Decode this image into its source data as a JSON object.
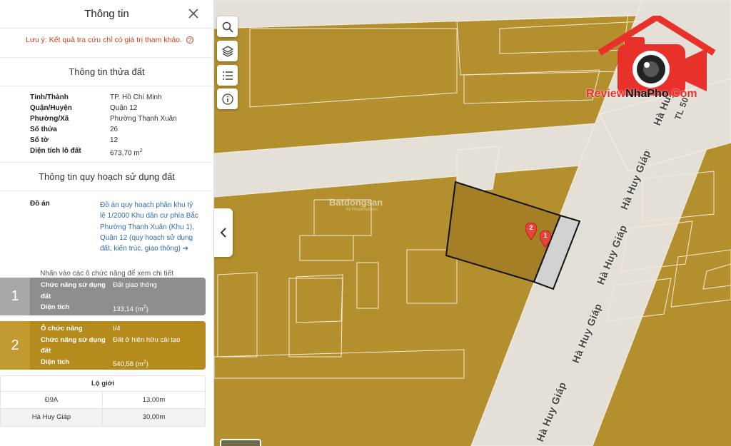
{
  "panel": {
    "title": "Thông tin",
    "note": "Lưu ý: Kết quả tra cứu chỉ có giá trị tham khảo.",
    "note_icon": "?",
    "land_section_title": "Thông tin thửa đất",
    "land_info": [
      {
        "label": "Tỉnh/Thành",
        "value": "TP. Hồ Chí Minh"
      },
      {
        "label": "Quận/Huyện",
        "value": "Quận 12"
      },
      {
        "label": "Phường/Xã",
        "value": "Phường Thạnh Xuân"
      },
      {
        "label": "Số thửa",
        "value": "26"
      },
      {
        "label": "Số tờ",
        "value": "12"
      },
      {
        "label": "Diện tích lô đất",
        "value": "673,70 m",
        "unit_sup": "2"
      }
    ],
    "planning_section_title": "Thông tin quy hoạch sử dụng đất",
    "project_label": "Đồ án",
    "project_link": "Đồ án quy hoạch phân khu tỷ lệ 1/2000 Khu dân cư phía Bắc Phường Thạnh Xuân (Khu 1), Quận 12 (quy hoạch sử dụng đất, kiến trúc, giao thông)",
    "project_arrow": "➔",
    "hint": "Nhấn vào các ô chức năng để xem chi tiết",
    "zones": [
      {
        "number": "1",
        "color": "#8e8e8e",
        "function_label": "Chức năng sử dụng đất",
        "function_value": "Đất giao thông",
        "area_label": "Diện tích",
        "area_value": "133,14 (m",
        "area_sup": "2",
        "area_close": ")"
      },
      {
        "number": "2",
        "color": "#b68b1e",
        "cell_label": "Ô chức năng",
        "cell_value": "I/4",
        "function_label": "Chức năng sử dụng đất",
        "function_value": "Đất ở hiện hữu cải tạo",
        "area_label": "Diện tích",
        "area_value": "540,58 (m",
        "area_sup": "2",
        "area_close": ")"
      }
    ],
    "road_width": {
      "title": "Lộ giới",
      "rows": [
        {
          "name": "Đ9A",
          "value": "13,00m"
        },
        {
          "name": "Hà Huy Giáp",
          "value": "30,00m"
        }
      ]
    }
  },
  "map": {
    "tools": [
      "search-icon",
      "layers-icon",
      "legend-list-icon",
      "info-icon"
    ],
    "road_labels": [
      "Hà Huy Giáp",
      "Hà Huy Giáp",
      "Hà Huy Giáp",
      "Hà Huy Giáp",
      "Hà Huy Giáp",
      "TL 50"
    ],
    "watermark": "Batdongsan",
    "watermark_sub": "by PropertyGuru",
    "pins": [
      "2",
      "1"
    ],
    "brand": {
      "part1": "Review",
      "part2": "NhaPho",
      "part3": ".Com"
    },
    "colors": {
      "land": "#b38f2e",
      "road": "#e4e0d8",
      "parcel_road": "#d2d2d2"
    }
  }
}
